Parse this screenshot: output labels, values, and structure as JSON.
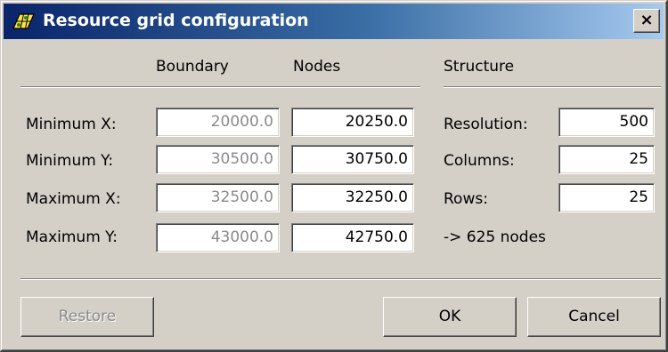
{
  "window": {
    "title": "Resource grid configuration",
    "close_label": "×"
  },
  "headers": {
    "boundary": "Boundary",
    "nodes": "Nodes",
    "structure": "Structure"
  },
  "rows": [
    {
      "label": "Minimum X:",
      "boundary": "20000.0",
      "nodes": "20250.0"
    },
    {
      "label": "Minimum Y:",
      "boundary": "30500.0",
      "nodes": "30750.0"
    },
    {
      "label": "Maximum X:",
      "boundary": "32500.0",
      "nodes": "32250.0"
    },
    {
      "label": "Maximum Y:",
      "boundary": "43000.0",
      "nodes": "42750.0"
    }
  ],
  "structure": {
    "resolution_label": "Resolution:",
    "resolution_value": "500",
    "columns_label": "Columns:",
    "columns_value": "25",
    "rows_label": "Rows:",
    "rows_value": "25",
    "summary": "-> 625 nodes"
  },
  "buttons": {
    "restore": "Restore",
    "ok": "OK",
    "cancel": "Cancel"
  },
  "colors": {
    "title_gradient_start": "#0a246a",
    "title_gradient_end": "#a6caf0",
    "face": "#d4d0c8",
    "disabled_text": "#8a8a8a"
  },
  "icons": {
    "title": "resource-grid-icon",
    "close": "close-icon"
  }
}
